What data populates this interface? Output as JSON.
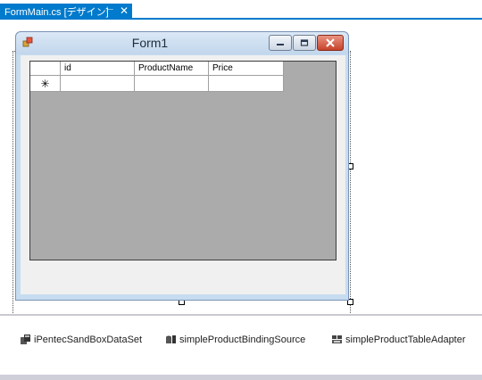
{
  "tab": {
    "title": "FormMain.cs [デザイン]",
    "pin_glyph": "⊢",
    "close_glyph": "✕"
  },
  "form": {
    "title": "Form1"
  },
  "grid": {
    "columns": [
      "id",
      "ProductName",
      "Price"
    ],
    "new_row_marker": "✳"
  },
  "tray": {
    "components": [
      "iPentecSandBoxDataSet",
      "simpleProductBindingSource",
      "simpleProductTableAdapter"
    ]
  },
  "colors": {
    "accent": "#007acc",
    "grid_background": "#ababab",
    "form_border": "#c6dcf0"
  }
}
